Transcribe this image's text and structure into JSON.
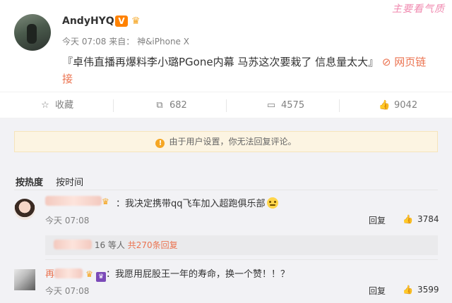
{
  "post": {
    "author": "AndyHYQ",
    "verified_badge": "V",
    "time": "今天 07:08",
    "from_label": "来自：",
    "source": "神&iPhone X",
    "text": "『卓伟直播再爆料李小璐PGone内幕 马苏这次要栽了 信息量太大』",
    "link_label": "网页链接",
    "watermark": "主要看气质"
  },
  "actions": {
    "collect": "收藏",
    "repost": "682",
    "comment": "4575",
    "like": "9042"
  },
  "notice": "由于用户设置，你无法回复评论。",
  "sort": {
    "hot": "按热度",
    "time": "按时间"
  },
  "comments": [
    {
      "text": "：我决定携带qq飞车加入超跑俱乐部",
      "time": "今天 07:08",
      "reply": "回复",
      "likes": "3784",
      "sub_count": "16 等人",
      "sub_total": "共270条回复"
    },
    {
      "name_prefix": "再",
      "text": "：我愿用屁股王一年的寿命，换一个赞！！？",
      "time": "今天 07:08",
      "reply": "回复",
      "likes": "3599"
    }
  ],
  "icons": [
    "star-icon",
    "repost-icon",
    "comment-icon",
    "thumb-up-icon",
    "warning-icon",
    "crown-icon",
    "vip-icon"
  ]
}
